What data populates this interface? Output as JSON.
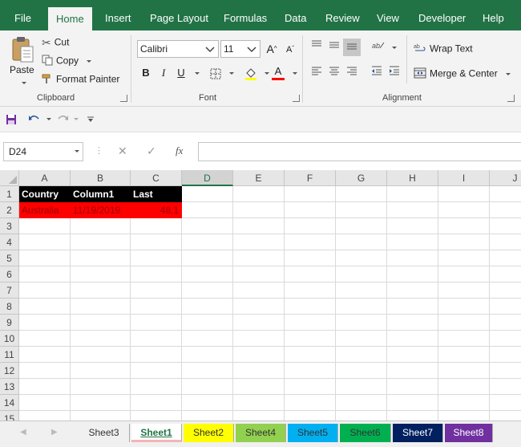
{
  "ribbon_tabs": [
    "File",
    "Home",
    "Insert",
    "Page Layout",
    "Formulas",
    "Data",
    "Review",
    "View",
    "Developer",
    "Help"
  ],
  "clipboard": {
    "paste_label": "Paste",
    "cut_label": "Cut",
    "copy_label": "Copy",
    "format_painter_label": "Format Painter",
    "group_label": "Clipboard"
  },
  "font": {
    "name": "Calibri",
    "size": "11",
    "bold": "B",
    "italic": "I",
    "underline": "U",
    "grow": "A",
    "shrink": "A",
    "font_color_glyph": "A",
    "group_label": "Font"
  },
  "alignment": {
    "wrap_text_label": "Wrap Text",
    "merge_center_label": "Merge & Center",
    "group_label": "Alignment"
  },
  "formula_bar": {
    "name_box": "D24",
    "fx_label": "fx",
    "value": ""
  },
  "columns": [
    "A",
    "B",
    "C",
    "D",
    "E",
    "F",
    "G",
    "H",
    "I",
    "J"
  ],
  "rows": [
    "1",
    "2",
    "3",
    "4",
    "5",
    "6",
    "7",
    "8",
    "9",
    "10",
    "11",
    "12",
    "13",
    "14",
    "15"
  ],
  "cells": {
    "A1": "Country",
    "B1": "Column1",
    "C1": "Last",
    "A2": "Australia",
    "B2": "11/19/2019",
    "C2": "48.1"
  },
  "sheet_tabs": [
    {
      "name": "Sheet3",
      "color": "#f0f0f0",
      "text": "#333333"
    },
    {
      "name": "Sheet1",
      "color": "#ffffff",
      "text": "#217346",
      "active": true
    },
    {
      "name": "Sheet2",
      "color": "#ffff00",
      "text": "#333333"
    },
    {
      "name": "Sheet4",
      "color": "#92d050",
      "text": "#333333"
    },
    {
      "name": "Sheet5",
      "color": "#00b0f0",
      "text": "#333333"
    },
    {
      "name": "Sheet6",
      "color": "#00b050",
      "text": "#333333"
    },
    {
      "name": "Sheet7",
      "color": "#002060",
      "text": "#ffffff"
    },
    {
      "name": "Sheet8",
      "color": "#7030a0",
      "text": "#ffffff"
    }
  ],
  "colors": {
    "brand": "#217346",
    "header_fill": "#000000",
    "row_fill": "#ff0000"
  }
}
